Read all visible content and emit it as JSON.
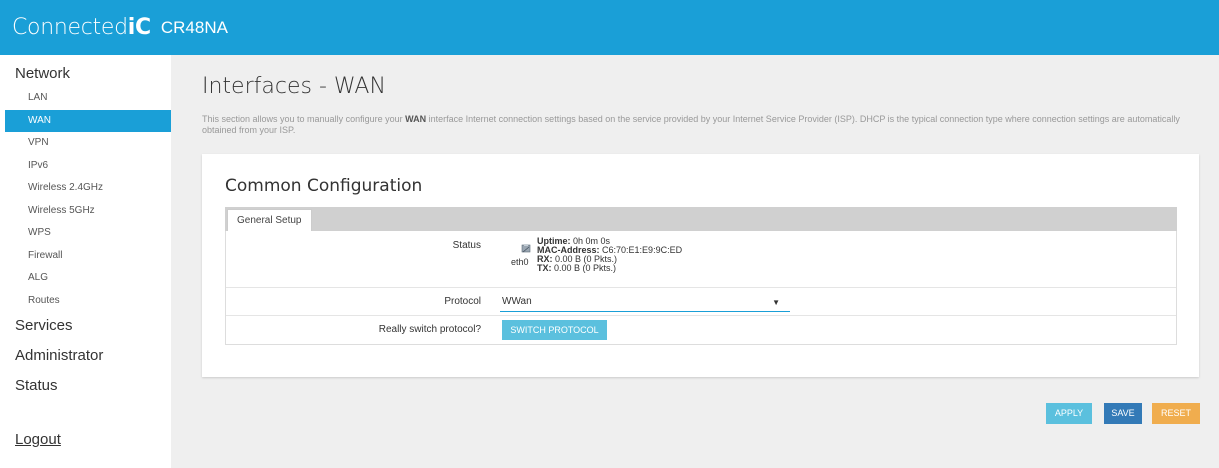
{
  "header": {
    "brand_light": "Connected",
    "brand_bold": "iC",
    "model": "CR48NA"
  },
  "sidebar": {
    "network": {
      "label": "Network",
      "items": [
        {
          "label": "LAN"
        },
        {
          "label": "WAN",
          "active": true
        },
        {
          "label": "VPN"
        },
        {
          "label": "IPv6"
        },
        {
          "label": "Wireless 2.4GHz"
        },
        {
          "label": "Wireless 5GHz"
        },
        {
          "label": "WPS"
        },
        {
          "label": "Firewall"
        },
        {
          "label": "ALG"
        },
        {
          "label": "Routes"
        }
      ]
    },
    "services": "Services",
    "administrator": "Administrator",
    "status": "Status",
    "logout": "Logout"
  },
  "page": {
    "title": "Interfaces - WAN",
    "desc_pre": "This section allows you to manually configure your ",
    "desc_bold": "WAN",
    "desc_post": " interface Internet connection settings based on the service provided by your Internet Service Provider (ISP). DHCP is the typical connection type where connection settings are automatically obtained from your ISP."
  },
  "config": {
    "title": "Common Configuration",
    "tab": "General Setup",
    "status": {
      "label": "Status",
      "device": "eth0",
      "uptime_label": "Uptime:",
      "uptime_value": "0h 0m 0s",
      "mac_label": "MAC-Address:",
      "mac_value": "C6:70:E1:E9:9C:ED",
      "rx_label": "RX:",
      "rx_value": "0.00 B (0 Pkts.)",
      "tx_label": "TX:",
      "tx_value": "0.00 B (0 Pkts.)"
    },
    "protocol": {
      "label": "Protocol",
      "selected": "WWan"
    },
    "switch": {
      "label": "Really switch protocol?",
      "button": "SWITCH PROTOCOL"
    }
  },
  "actions": {
    "apply": "APPLY",
    "save": "SAVE",
    "reset": "RESET"
  },
  "colors": {
    "accent": "#1a9fd7",
    "apply": "#5bc0de",
    "save": "#337ab7",
    "reset": "#f0ad4e"
  }
}
